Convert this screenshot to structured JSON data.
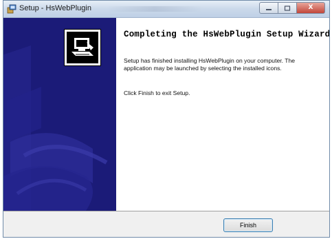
{
  "window": {
    "title": "Setup - HsWebPlugin",
    "icon": "setup-installer-icon",
    "controls": {
      "minimize": "minimize-icon",
      "maximize": "maximize-icon",
      "close_label": "X"
    }
  },
  "sidebar": {
    "logo_icon": "computer-install-icon",
    "background_color": "#1b1b78"
  },
  "content": {
    "heading": "Completing the HsWebPlugin Setup Wizard",
    "paragraph1": "Setup has finished installing HsWebPlugin on your computer. The application may be launched by selecting the installed icons.",
    "paragraph2": "Click Finish to exit Setup."
  },
  "footer": {
    "finish_label": "Finish"
  },
  "colors": {
    "accent": "#3c7fb1",
    "sidebar": "#1b1b78"
  }
}
